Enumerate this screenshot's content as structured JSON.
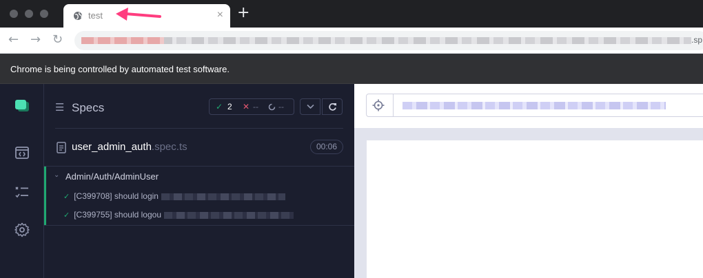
{
  "browser": {
    "tab": {
      "title": "test",
      "close": "×"
    },
    "new_tab": "+",
    "toolbar": {
      "back": "←",
      "forward": "→",
      "reload": "↻",
      "url_tail": ".sp"
    },
    "infobar": "Chrome is being controlled by automated test software."
  },
  "cypress": {
    "specs_icon": "☰",
    "specs_title": "Specs",
    "stats": {
      "passed": "2",
      "failed": "--",
      "pending": "--"
    },
    "spec": {
      "name": "user_admin_auth",
      "ext": ".spec.ts",
      "duration": "00:06"
    },
    "suite": {
      "title": "Admin/Auth/AdminUser"
    },
    "tests": [
      {
        "title": "[C399708] should login"
      },
      {
        "title": "[C399755] should logou"
      }
    ]
  },
  "colors": {
    "pass": "#1fa971",
    "fail": "#e45770",
    "accent": "#ff3d7f"
  },
  "icons": [
    "globe-icon",
    "back-icon",
    "forward-icon",
    "reload-icon",
    "cypress-logo-icon",
    "runs-icon",
    "tests-list-icon",
    "settings-icon",
    "file-icon",
    "check-icon",
    "x-icon",
    "spinner-icon",
    "chevron-down-icon",
    "refresh-icon",
    "crosshair-icon",
    "annotation-arrow-icon"
  ]
}
